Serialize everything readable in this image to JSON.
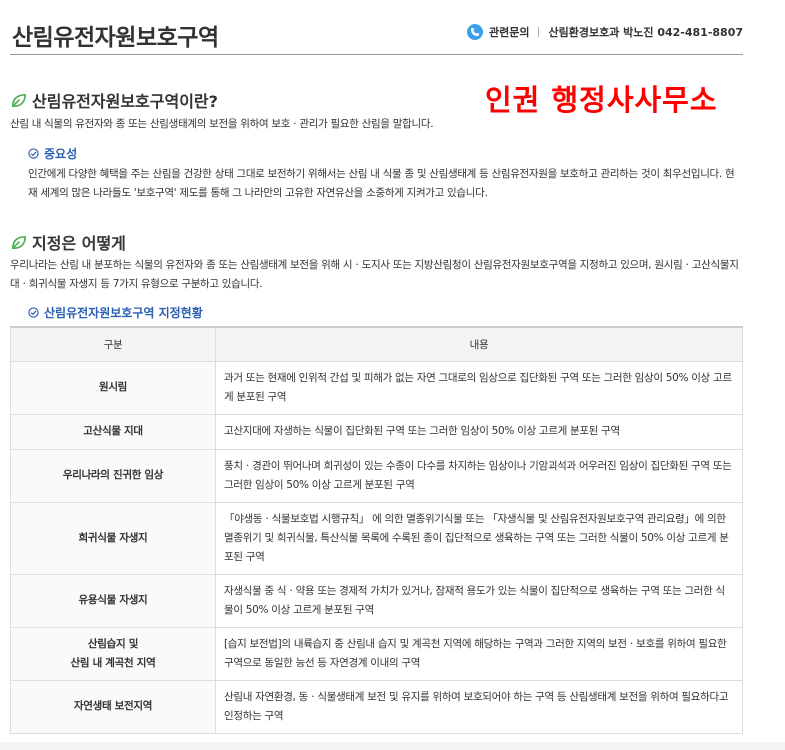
{
  "page": {
    "title": "산림유전자원보호구역"
  },
  "contact": {
    "label": "관련문의",
    "value": "산림환경보호과 박노진 042-481-8807",
    "icon": "phone-icon"
  },
  "watermark": "인권 행정사사무소",
  "section_intro": {
    "heading": "산림유전자원보호구역이란?",
    "icon": "leaf-icon",
    "text": "산림 내 식물의 유전자와 종 또는 산림생태계의 보전을 위하여 보호ㆍ관리가 필요한 산림을 말합니다."
  },
  "importance": {
    "heading": "중요성",
    "icon": "check-circle-icon",
    "text": "인간에게 다양한 혜택을 주는 산림을 건강한 상태 그대로 보전하기 위해서는 산림 내 식물 종 및 산림생태계 등 산림유전자원을 보호하고 관리하는 것이 최우선입니다. 현재 세계의 많은 나라들도 '보호구역' 제도를 통해 그 나라만의 고유한 자연유산을 소중하게 지켜가고 있습니다."
  },
  "section_designation": {
    "heading": "지정은 어떻게",
    "icon": "leaf-icon",
    "text": "우리나라는 산림 내 분포하는 식물의 유전자와 종 또는 산림생태계 보전을 위해 시ㆍ도지사 또는 지방산림청이 산림유전자원보호구역을 지정하고 있으며, 원시림ㆍ고산식물지대ㆍ희귀식물 자생지 등 7가지 유형으로 구분하고 있습니다."
  },
  "status": {
    "heading": "산림유전자원보호구역 지정현황",
    "icon": "check-circle-icon",
    "columns": [
      "구분",
      "내용"
    ],
    "rows": [
      {
        "category": "원시림",
        "content": "과거 또는 현재에 인위적 간섭 및 피해가 없는 자연 그대로의 임상으로 집단화된 구역 또는 그러한 임상이 50% 이상 고르게 분포된 구역"
      },
      {
        "category": "고산식물 지대",
        "content": "고산지대에 자생하는 식물이 집단화된 구역 또는 그러한 임상이 50% 이상 고르게 분포된 구역"
      },
      {
        "category": "우리나라의 진귀한 임상",
        "content": "풍치ㆍ경관이 뛰어나며 희귀성이 있는 수종이 다수를 차지하는 임상이나 기암괴석과 어우러진 임상이 집단화된 구역 또는 그러한 임상이 50% 이상 고르게 분포된 구역"
      },
      {
        "category": "희귀식물 자생지",
        "content": "「야생동ㆍ식물보호법 시행규칙」 에 의한 멸종위기식물 또는 「자생식물 및 산림유전자원보호구역 관리요령」에 의한 멸종위기 및 희귀식물, 특산식물 목록에 수록된 종이 집단적으로 생육하는 구역 또는 그러한 식물이 50% 이상 고르게 분포된 구역"
      },
      {
        "category": "유용식물 자생지",
        "content": "자생식물 중 식ㆍ약용 또는 경제적 가치가 있거나, 잠재적 용도가 있는 식물이 집단적으로 생육하는 구역 또는 그러한 식물이 50% 이상 고르게 분포된 구역"
      },
      {
        "category": "산림습지 및\n산림 내 계곡천 지역",
        "content": "[습지 보전법]의 내륙습지 중 산림내 습지 및 계곡천 지역에 해당하는 구역과 그러한 지역의 보전ㆍ보호를 위하여 필요한 구역으로 동일한 능선 등 자연경계 이내의 구역"
      },
      {
        "category": "자연생태 보전지역",
        "content": "산림내 자연환경, 동ㆍ식물생태계 보전 및 유지를 위하여 보호되어야 하는 구역 등 산림생태계 보전을 위하여 필요하다고 인정하는 구역"
      }
    ]
  },
  "colors": {
    "accent_blue": "#2b5fb4",
    "phone_blue": "#3aa0e8",
    "leaf_green": "#4caf50",
    "watermark_red": "#ff0000"
  }
}
